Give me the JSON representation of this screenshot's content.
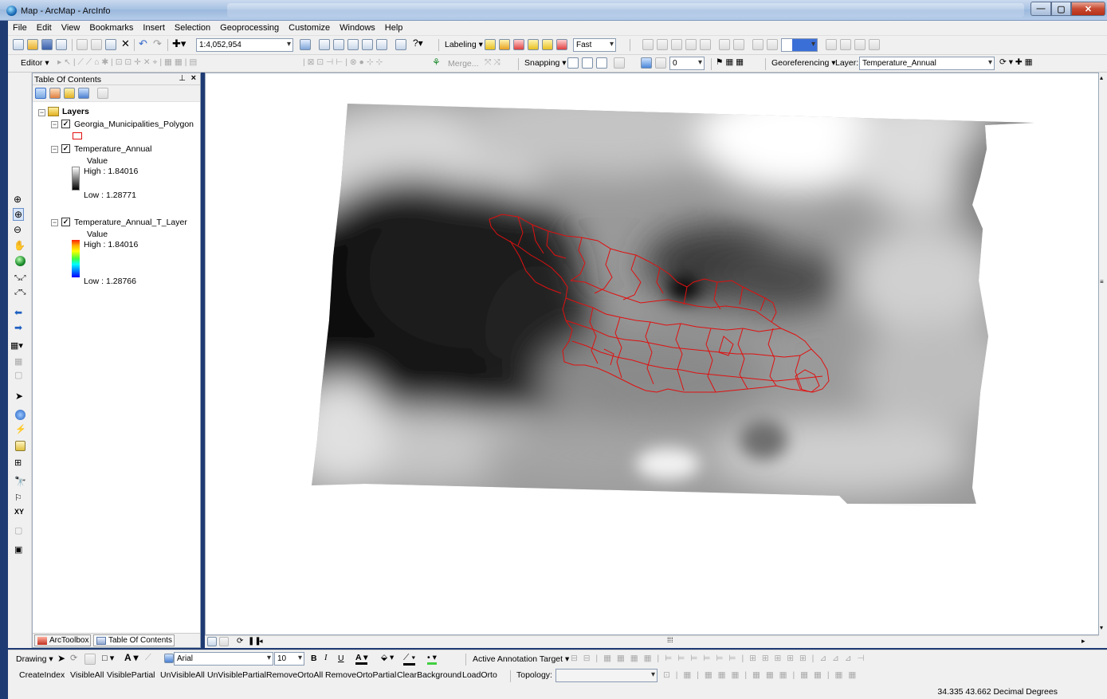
{
  "window": {
    "title": "Map - ArcMap - ArcInfo"
  },
  "menu": [
    "File",
    "Edit",
    "View",
    "Bookmarks",
    "Insert",
    "Selection",
    "Geoprocessing",
    "Customize",
    "Windows",
    "Help"
  ],
  "standard_toolbar": {
    "scale": "1:4,052,954"
  },
  "labeling_toolbar": {
    "label": "Labeling",
    "mode": "Fast"
  },
  "editor_toolbar": {
    "label": "Editor",
    "merge_label": "Merge...",
    "snapping_label": "Snapping",
    "spin_value": "0"
  },
  "georef_toolbar": {
    "label": "Georeferencing",
    "layer_label": "Layer:",
    "layer_value": "Temperature_Annual"
  },
  "toc": {
    "title": "Table Of Contents",
    "root": "Layers",
    "layers": [
      {
        "name": "Georgia_Municipalities_Polygon"
      },
      {
        "name": "Temperature_Annual",
        "value_label": "Value",
        "high": "High : 1.84016",
        "low": "Low : 1.28771"
      },
      {
        "name": "Temperature_Annual_T_Layer",
        "value_label": "Value",
        "high": "High : 1.84016",
        "low": "Low : 1.28766"
      }
    ],
    "tabs": [
      "ArcToolbox",
      "Table Of Contents"
    ]
  },
  "drawing_toolbar": {
    "label": "Drawing",
    "font": "Arial",
    "size": "10",
    "annotation_label": "Active Annotation Target"
  },
  "custom_toolbar": {
    "buttons": [
      "CreateIndex",
      "VisibleAll",
      "VisiblePartial",
      "UnVisibleAll",
      "UnVisiblePartial",
      "RemoveOrtoAll",
      "RemoveOrtoPartial",
      "ClearBackground",
      "LoadOrto"
    ],
    "topology_label": "Topology:"
  },
  "status": {
    "coords": "34.335  43.662 Decimal Degrees"
  },
  "colors": {
    "polygon_outline": "#e01010",
    "title_bar": "#a9c3e4",
    "desktop": "#1f3b73"
  }
}
